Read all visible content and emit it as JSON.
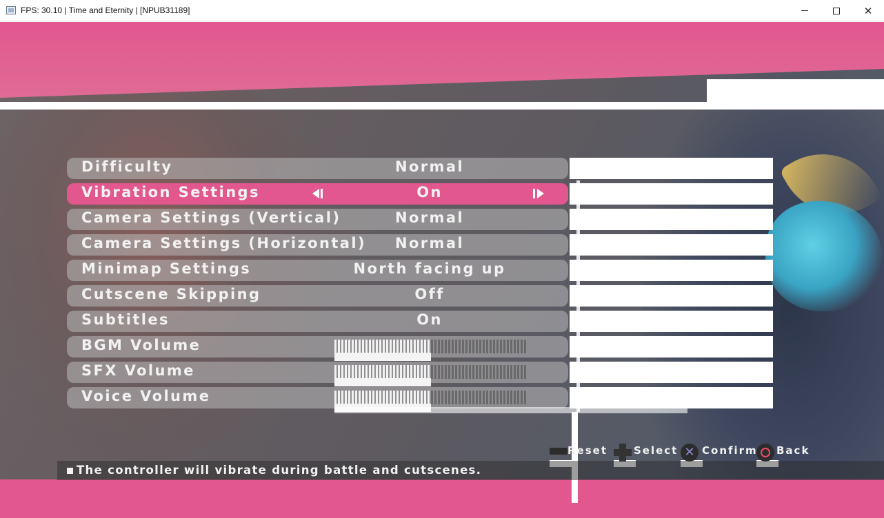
{
  "window": {
    "title": "FPS: 30.10 | Time and Eternity | [NPUB31189]",
    "minimize_icon": "minimize-icon",
    "maximize_icon": "maximize-icon",
    "close_icon": "close-icon",
    "close_glyph": "✕"
  },
  "colors": {
    "accent_pink": "#e3578f",
    "row_bg": "#b9b9b9",
    "text": "#f2f2f2"
  },
  "settings": [
    {
      "label": "Difficulty",
      "value": "Normal"
    },
    {
      "label": "Vibration Settings",
      "value": "On",
      "selected": true
    },
    {
      "label": "Camera Settings (Vertical)",
      "value": "Normal"
    },
    {
      "label": "Camera Settings (Horizontal)",
      "value": "Normal"
    },
    {
      "label": "Minimap Settings",
      "value": "North facing up"
    },
    {
      "label": "Cutscene Skipping",
      "value": "Off"
    },
    {
      "label": "Subtitles",
      "value": "On"
    }
  ],
  "volumes": [
    {
      "label": "BGM Volume",
      "level": 0.5
    },
    {
      "label": "SFX Volume",
      "level": 0.5
    },
    {
      "label": "Voice Volume",
      "level": 0.5
    }
  ],
  "prompts": [
    {
      "label": "Reset",
      "icon": "select-button-icon"
    },
    {
      "label": "Select",
      "icon": "dpad-icon"
    },
    {
      "label": "Confirm",
      "icon": "cross-button-icon"
    },
    {
      "label": "Back",
      "icon": "circle-button-icon"
    }
  ],
  "help": {
    "text": "The controller will vibrate during battle and cutscenes."
  }
}
